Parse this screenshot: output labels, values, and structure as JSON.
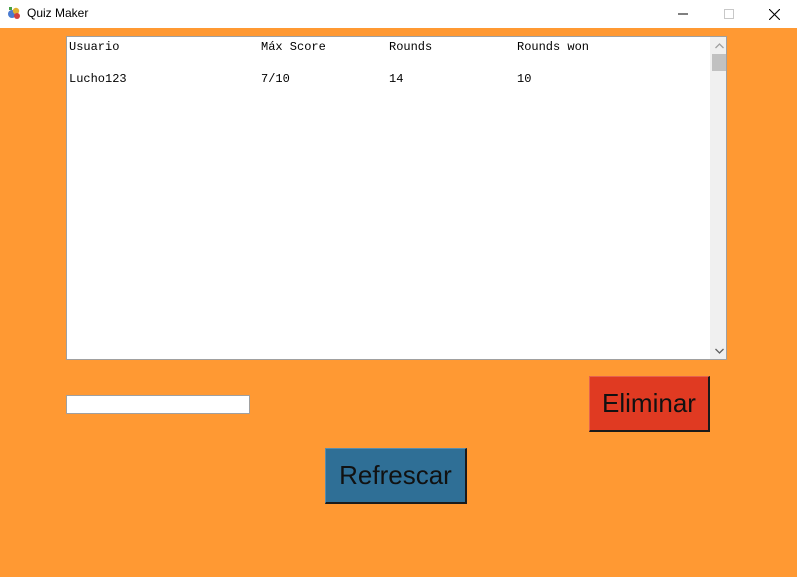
{
  "window": {
    "title": "Quiz Maker",
    "app_icon": "quiz-maker-app-icon",
    "controls": [
      "minimize-icon",
      "maximize-icon",
      "close-icon"
    ]
  },
  "colors": {
    "background": "#ff9933",
    "eliminar_button": "#e03a22",
    "refrescar_button": "#2f6f96"
  },
  "listbox": {
    "header": [
      "Usuario",
      "Máx Score",
      "Rounds",
      "Rounds won"
    ],
    "rows": [
      [
        "Lucho123",
        "7/10",
        "14",
        "10"
      ]
    ]
  },
  "entry": {
    "value": "",
    "placeholder": ""
  },
  "buttons": {
    "eliminar": "Eliminar",
    "refrescar": "Refrescar"
  }
}
